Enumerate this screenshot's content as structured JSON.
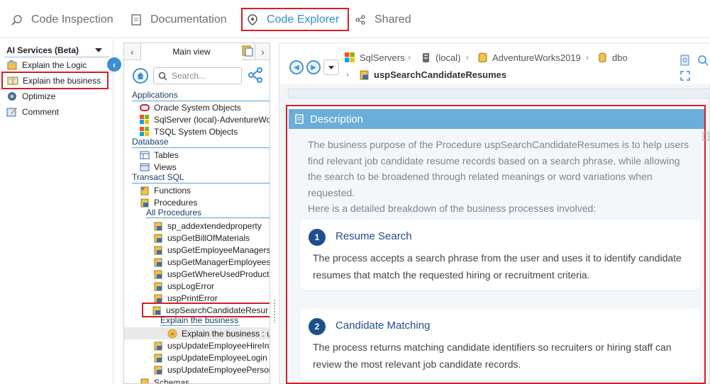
{
  "tabs": [
    {
      "label": "Code Inspection",
      "icon": "code-inspection-icon"
    },
    {
      "label": "Documentation",
      "icon": "documentation-icon"
    },
    {
      "label": "Code Explorer",
      "icon": "explorer-icon",
      "active": true
    },
    {
      "label": "Shared",
      "icon": "share-icon"
    }
  ],
  "ai": {
    "header": "AI Services (Beta)",
    "items": [
      {
        "label": "Explain the Logic"
      },
      {
        "label": "Explain the business",
        "selected": true
      },
      {
        "label": "Optimize"
      },
      {
        "label": "Comment"
      }
    ]
  },
  "tree": {
    "tab_label": "Main view",
    "search_placeholder": "Search...",
    "sections": {
      "applications": "Applications",
      "database": "Database",
      "transact": "Transact SQL"
    },
    "applications": [
      "Oracle System Objects",
      "SqlServer (local)-AdventureWo",
      "TSQL System Objects"
    ],
    "database": [
      "Tables",
      "Views"
    ],
    "transact": [
      "Functions",
      "Procedures"
    ],
    "all_procedures": "All Procedures",
    "procedures": [
      "sp_addextendedproperty",
      "uspGetBillOfMaterials",
      "uspGetEmployeeManagers",
      "uspGetManagerEmployees",
      "uspGetWhereUsedProductI",
      "uspLogError",
      "uspPrintError",
      "uspSearchCandidateResur"
    ],
    "explain_label": "Explain the business",
    "explain_item": "Explain the business : u",
    "procedures_after": [
      "uspUpdateEmployeeHireInf",
      "uspUpdateEmployeeLogin",
      "uspUpdateEmployeePerson"
    ],
    "schemas": "Schemas"
  },
  "breadcrumb": {
    "items": [
      "SqlServers",
      "(local)",
      "AdventureWorks2019",
      "dbo"
    ],
    "current": "uspSearchCandidateResumes"
  },
  "description": {
    "heading": "Description",
    "intro": "The business purpose of the Procedure uspSearchCandidateResumes is to help users find relevant job candidate resume records based on a search phrase, while allowing the search to be broadened through related meanings or word variations when requested.",
    "intro2": "Here is a detailed breakdown of the business processes involved:",
    "steps": [
      {
        "num": "1",
        "title": "Resume Search",
        "body": "The process accepts a search phrase from the user and uses it to identify candidate resumes that match the requested hiring or recruitment criteria."
      },
      {
        "num": "2",
        "title": "Candidate Matching",
        "body": "The process returns matching candidate identifiers so recruiters or hiring staff can review the most relevant job candidate records."
      }
    ]
  },
  "colors": {
    "accent": "#2f8fd6",
    "highlight": "#d1202a",
    "header": "#6aaed9",
    "step": "#1e4f8c"
  }
}
